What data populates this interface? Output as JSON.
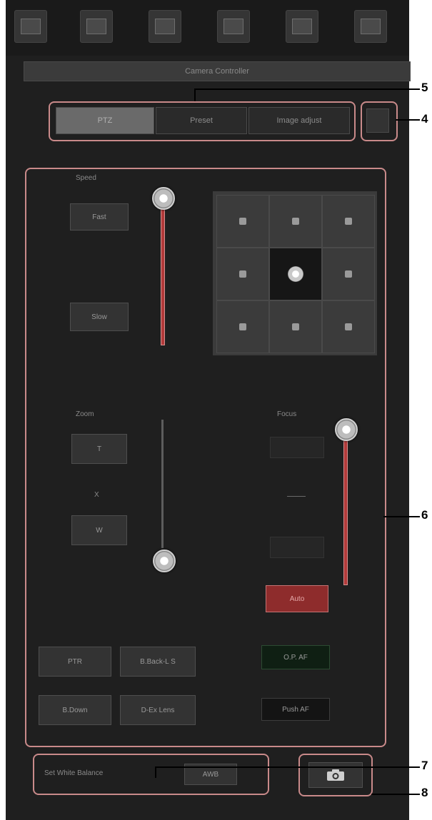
{
  "header": {
    "title": "Camera Controller"
  },
  "tabs": [
    {
      "label": "PTZ",
      "active": true
    },
    {
      "label": "Preset",
      "active": false
    },
    {
      "label": "Image adjust",
      "active": false
    }
  ],
  "speed": {
    "label": "Speed",
    "fast_label": "Fast",
    "slow_label": "Slow"
  },
  "zoom": {
    "label": "Zoom",
    "tele_label": "T",
    "x_label": "X",
    "wide_label": "W"
  },
  "focus": {
    "label": "Focus",
    "auto_label": "Auto"
  },
  "bottom_buttons": {
    "ptr": "PTR",
    "btn2": "B.Back-L S",
    "btn3": "B.Down",
    "btn4": "D-Ex Lens"
  },
  "focus_buttons": {
    "one_push": "O.P. AF",
    "push_af": "Push AF"
  },
  "footer": {
    "label": "Set White Balance",
    "value": "AWB"
  },
  "callouts": [
    "5",
    "4",
    "6",
    "7",
    "8"
  ],
  "icons": [
    "grid-icon",
    "square-icon",
    "camera-icon"
  ],
  "colors": {
    "annotation": "#c98a8a",
    "auto_btn": "#8e2c2c",
    "background": "#1f1f1f"
  }
}
